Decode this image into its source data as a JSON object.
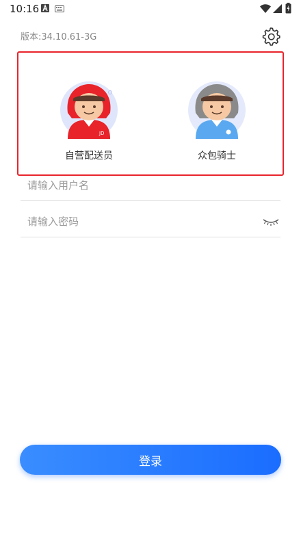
{
  "status_bar": {
    "time": "10:16",
    "icons": [
      "notification-a-icon",
      "keyboard-icon",
      "wifi-icon",
      "signal-icon",
      "battery-charging-icon"
    ]
  },
  "header": {
    "version": "版本:34.10.61-3G",
    "settings_icon": "gear-icon"
  },
  "roles": [
    {
      "label": "自营配送员",
      "helmet_color": "#e8232a",
      "vest_color": "#e8232a",
      "badge": "JD"
    },
    {
      "label": "众包骑士",
      "helmet_color": "#8a8a8a",
      "vest_color": "#5aa9f0"
    }
  ],
  "highlight_color": "#e8232a",
  "form": {
    "username_placeholder": "请输入用户名",
    "password_placeholder": "请输入密码",
    "password_toggle_icon": "eye-closed-icon"
  },
  "login_button": {
    "label": "登录",
    "color": "#2a7dff"
  }
}
